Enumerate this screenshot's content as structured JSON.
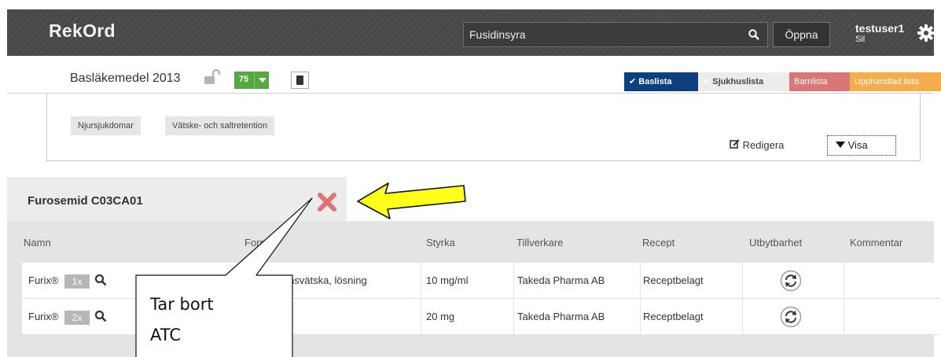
{
  "header": {
    "app_title": "RekOrd",
    "search_value": "Fusidinsyra",
    "open_label": "Öppna",
    "user_name": "testuser1",
    "user_sub": "Sil"
  },
  "listbar": {
    "list_title": "Basläkemedel 2013",
    "count": "75",
    "tabs": [
      "Baslista",
      "Sjukhuslista",
      "Barnlista",
      "Upphandlad lista"
    ]
  },
  "filters": {
    "chips": [
      "Njursjukdomar",
      "Vätske- och saltretention"
    ],
    "edit_label": "Redigera",
    "show_label": "Visa"
  },
  "substance": {
    "title": "Furosemid C03CA01",
    "columns": [
      "Namn",
      "Form",
      "Styrka",
      "Tillverkare",
      "Recept",
      "Utbytbarhet",
      "Kommentar"
    ],
    "rows": [
      {
        "name": "Furix®",
        "mult": "1x",
        "form": "nsvätska, lösning",
        "strength": "10 mg/ml",
        "maker": "Takeda Pharma AB",
        "recept": "Receptbelagt"
      },
      {
        "name": "Furix®",
        "mult": "2x",
        "form": "",
        "strength": "20 mg",
        "maker": "Takeda Pharma AB",
        "recept": "Receptbelagt"
      }
    ]
  },
  "annotation": {
    "callout_lines": [
      "Tar bort",
      "ATC"
    ]
  },
  "colors": {
    "baslista": "#0d3f7e",
    "barnlista": "#d97777",
    "upphandlad": "#f4ad4a",
    "badge_green": "#53a840",
    "remove_red": "#e37373",
    "arrow_yellow": "#ffff1a"
  }
}
